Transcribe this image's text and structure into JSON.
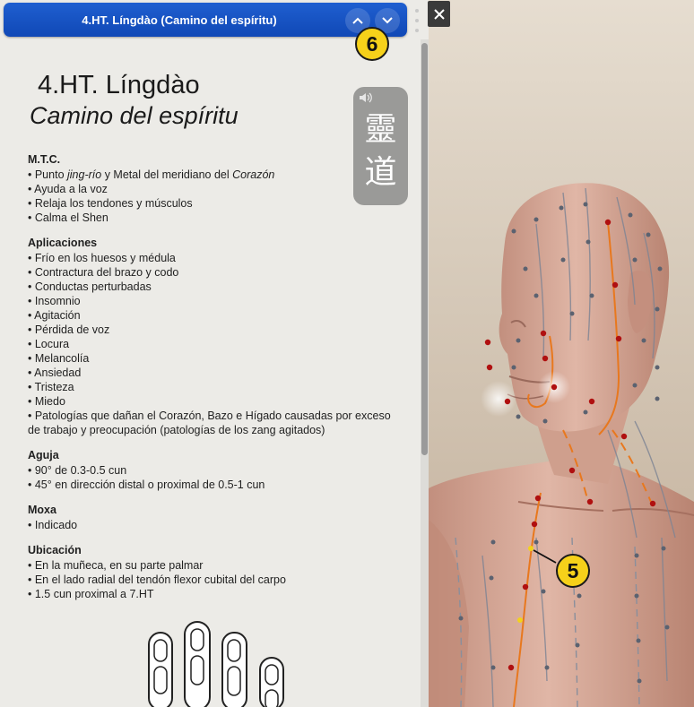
{
  "window": {
    "title": "4.HT. Língdào (Camino del espíritu)",
    "prev_icon": "chevron-up-icon",
    "next_icon": "chevron-down-icon",
    "menu_icon": "kebab-menu-icon",
    "close_icon": "close-icon"
  },
  "point": {
    "name": "4.HT. Língdào",
    "translation": "Camino del espíritu",
    "chinese_characters": "靈道",
    "audio_icon": "speaker-icon"
  },
  "sections": {
    "mtc": {
      "heading": "M.T.C.",
      "item1_a": "• Punto ",
      "item1_b": "jing-río",
      "item1_c": " y Metal del meridiano del ",
      "item1_d": "Corazón",
      "items": [
        "• Ayuda a la voz",
        "• Relaja los tendones y músculos",
        "• Calma el Shen"
      ]
    },
    "aplicaciones": {
      "heading": "Aplicaciones",
      "items": [
        "• Frío en los huesos y médula",
        "• Contractura del brazo y codo",
        "• Conductas perturbadas",
        "• Insomnio",
        "• Agitación",
        "• Pérdida de voz",
        "• Locura",
        "• Melancolía",
        "• Ansiedad",
        "• Tristeza",
        "• Miedo",
        "• Patologías que dañan el Corazón, Bazo e Hígado causadas por exceso de trabajo y preocupación (patologías de los zang agitados)"
      ]
    },
    "aguja": {
      "heading": "Aguja",
      "items": [
        "• 90° de 0.3-0.5 cun",
        "• 45° en dirección distal o proximal de 0.5-1 cun"
      ]
    },
    "moxa": {
      "heading": "Moxa",
      "items": [
        "• Indicado"
      ]
    },
    "ubicacion": {
      "heading": "Ubicación",
      "items": [
        "• En la muñeca, en su parte palmar",
        "• En el lado radial del tendón flexor cubital del carpo",
        "• 1.5 cun proximal a 7.HT"
      ]
    }
  },
  "callouts": {
    "badge_6": "6",
    "badge_5": "5"
  },
  "colors": {
    "titlebar": "#1653c4",
    "badge": "#f6d11a",
    "meridian": "#e8781e",
    "point_red": "#b01010",
    "point_gray": "#5b6270"
  }
}
